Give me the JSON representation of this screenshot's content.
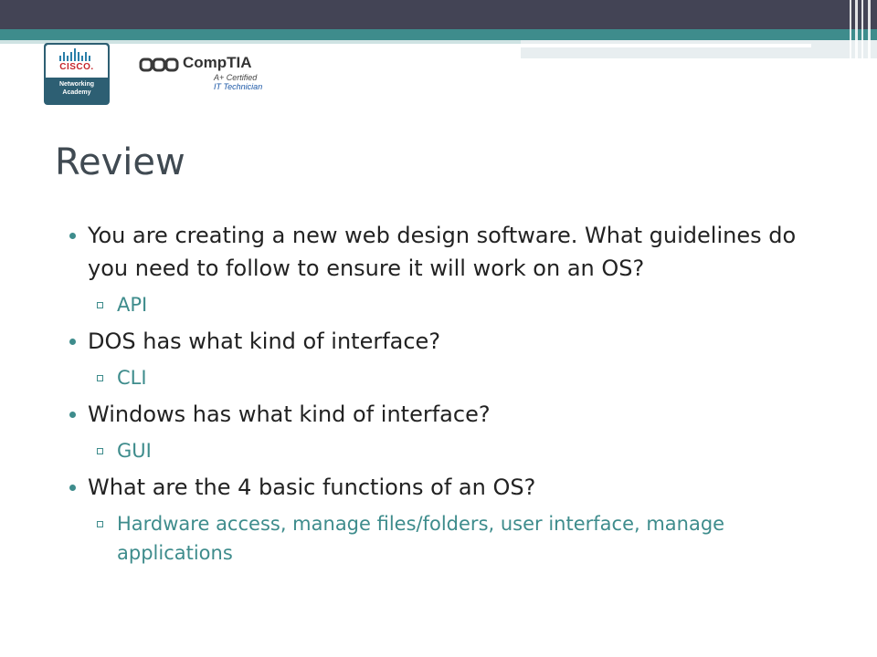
{
  "logos": {
    "cisco_word": "CISCO.",
    "cisco_sub_line1": "Networking",
    "cisco_sub_line2": "Academy",
    "comptia_brand": "CompTIA",
    "comptia_cert_line1": "A+ Certified",
    "comptia_cert_line2": "IT Technician"
  },
  "slide": {
    "title": "Review",
    "items": [
      {
        "text": "You are creating a new web design software. What guidelines do you need to follow to ensure it will work on an OS?",
        "answer": "API"
      },
      {
        "text": "DOS has what kind of interface?",
        "answer": "CLI"
      },
      {
        "text": "Windows has what kind of interface?",
        "answer": "GUI"
      },
      {
        "text": "What are the 4 basic functions of an OS?",
        "answer": "Hardware access, manage files/folders, user interface, manage applications"
      }
    ]
  },
  "colors": {
    "header_dark": "#434455",
    "accent_teal": "#3e8c8c",
    "title_color": "#404a52",
    "cisco_red": "#c6262c"
  }
}
